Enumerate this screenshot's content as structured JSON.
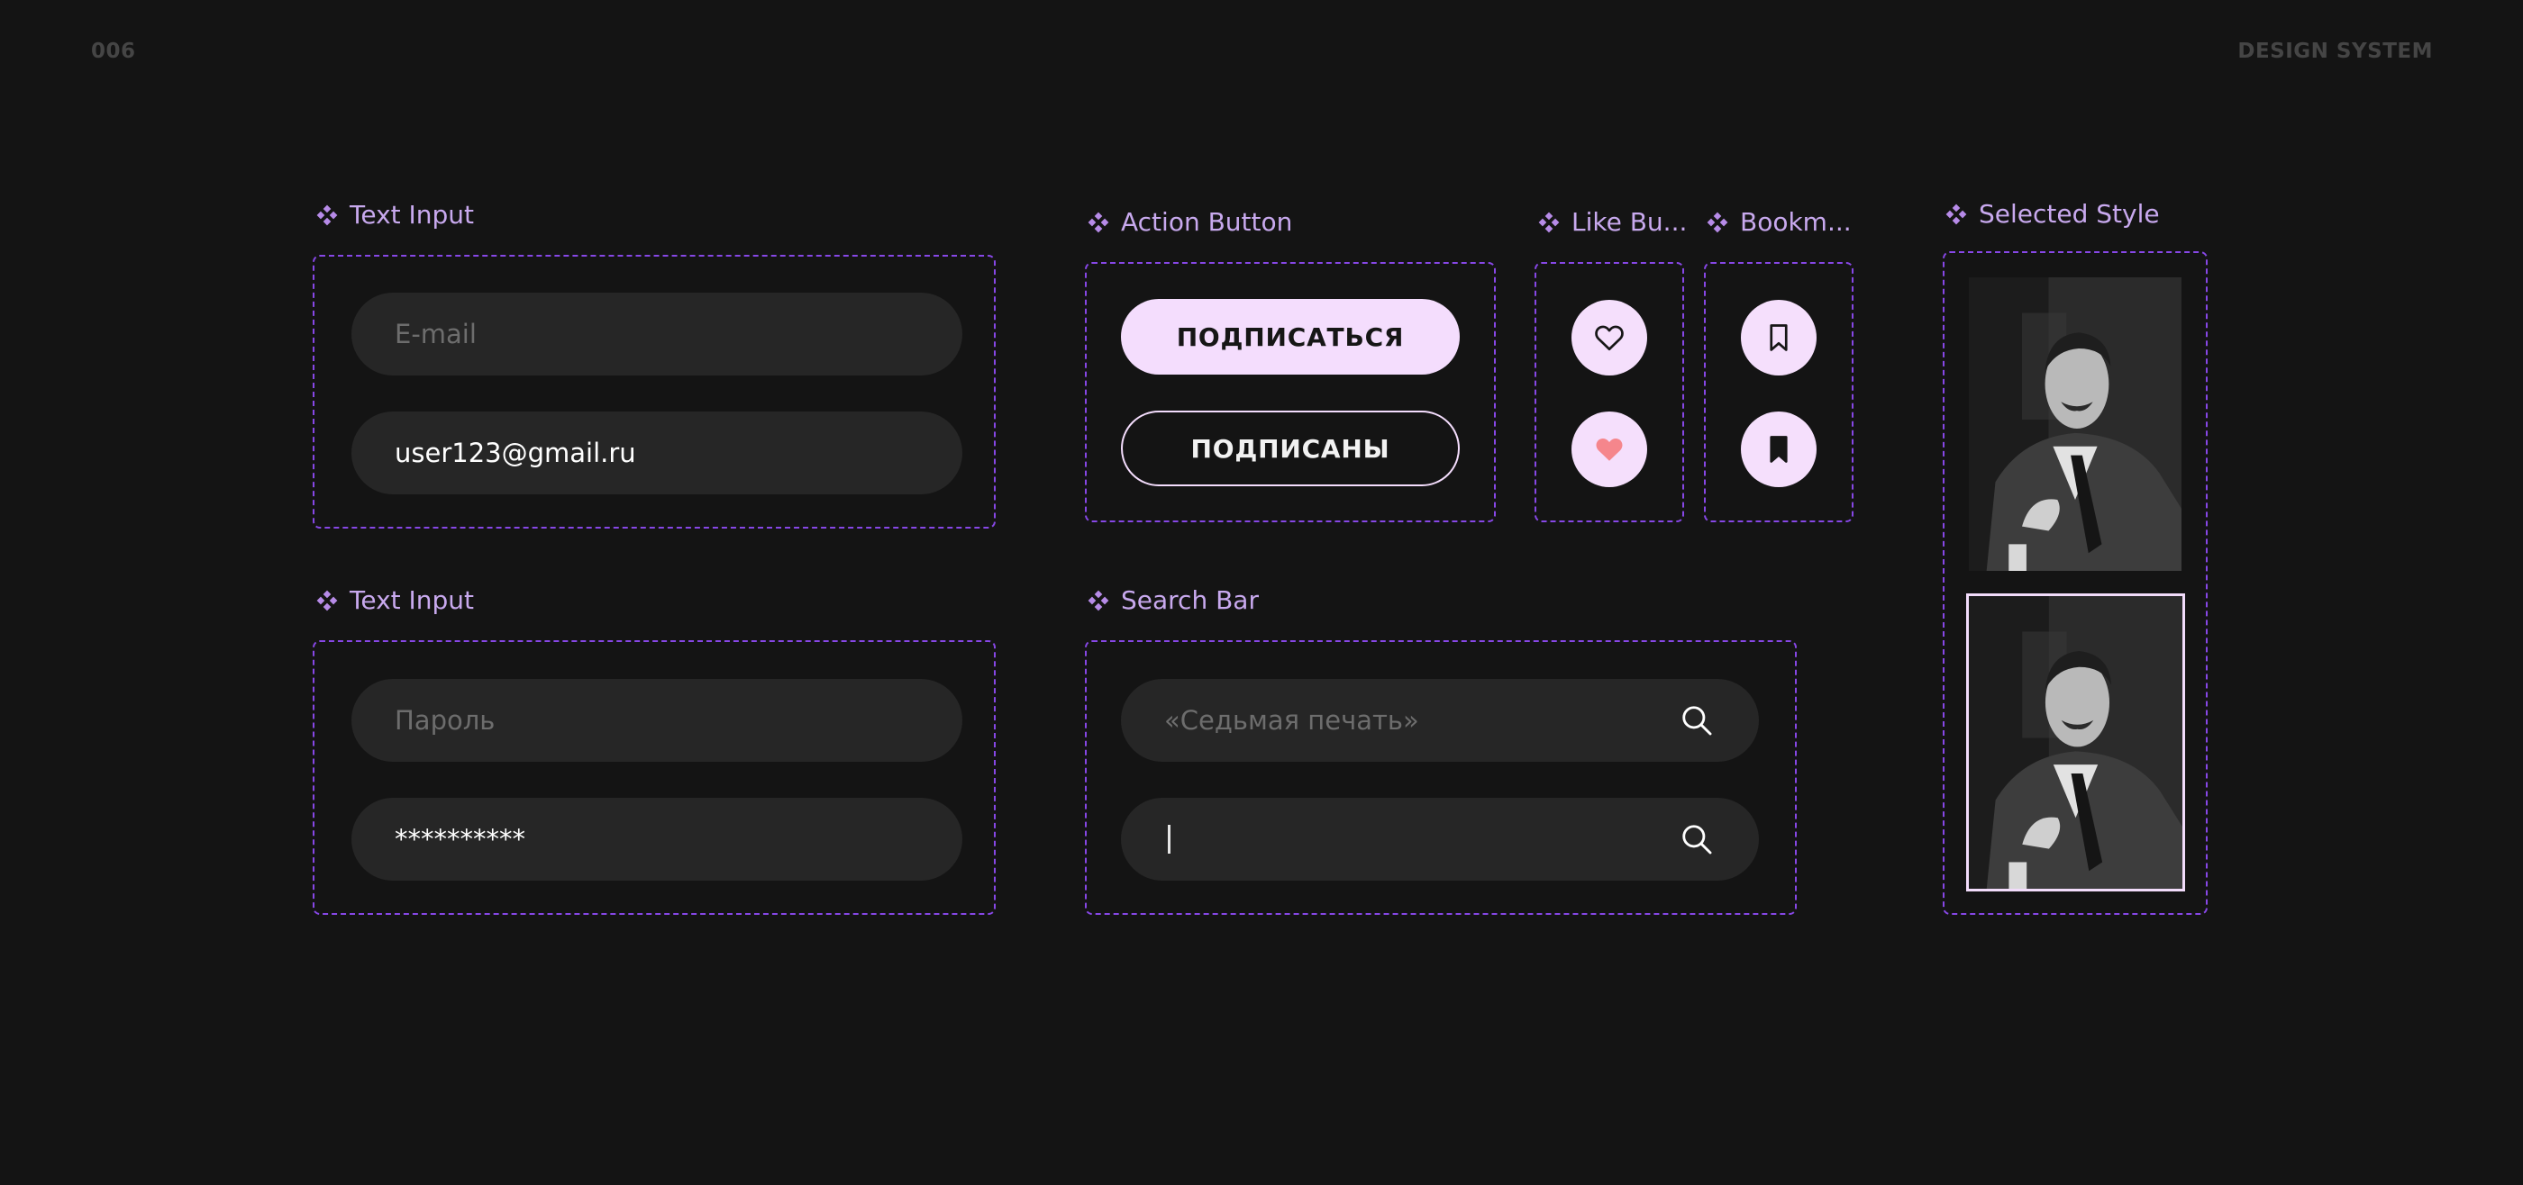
{
  "header": {
    "page_number": "006",
    "section": "DESIGN SYSTEM"
  },
  "components": {
    "text_input_email": {
      "title": "Text Input",
      "placeholder": "E-mail",
      "value": "user123@gmail.ru"
    },
    "text_input_password": {
      "title": "Text Input",
      "placeholder": "Пароль",
      "value": "**********"
    },
    "action_button": {
      "title": "Action Button",
      "subscribe_label": "ПОДПИСАТЬСЯ",
      "subscribed_label": "ПОДПИСАНЫ"
    },
    "like_button": {
      "title": "Like Bu..."
    },
    "bookmark_button": {
      "title": "Bookm..."
    },
    "search_bar": {
      "title": "Search Bar",
      "placeholder": "«Седьмая печать»"
    },
    "selected_style": {
      "title": "Selected Style"
    }
  },
  "colors": {
    "background": "#141414",
    "accent_dashed": "#8747e6",
    "title_lilac": "#c8a9ee",
    "button_fill": "#f4ddfd",
    "field_bg": "#262626",
    "heart_fill": "#f5868c"
  },
  "icons": [
    "component-icon",
    "heart-outline-icon",
    "heart-filled-icon",
    "bookmark-outline-icon",
    "bookmark-filled-icon",
    "search-icon"
  ]
}
